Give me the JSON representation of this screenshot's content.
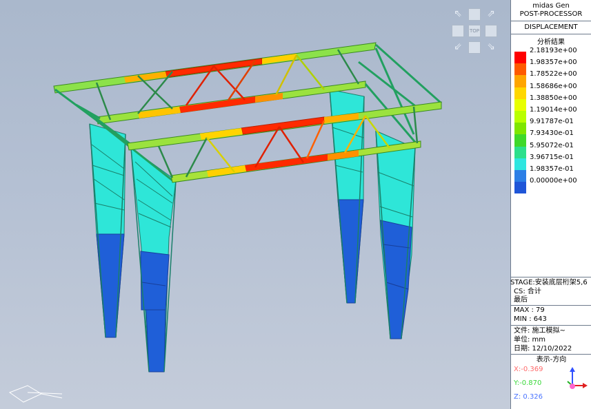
{
  "app": {
    "name": "midas Gen",
    "mode": "POST-PROCESSOR",
    "result_type": "DISPLACEMENT",
    "legend_title": "分析结果"
  },
  "legend": {
    "levels": [
      {
        "value": "2.18193e+00",
        "color": "#ff0000"
      },
      {
        "value": "1.98357e+00",
        "color": "#ff5a00"
      },
      {
        "value": "1.78522e+00",
        "color": "#ffa500"
      },
      {
        "value": "1.58686e+00",
        "color": "#ffd700"
      },
      {
        "value": "1.38850e+00",
        "color": "#e8ff00"
      },
      {
        "value": "1.19014e+00",
        "color": "#b9ff00"
      },
      {
        "value": "9.91787e-01",
        "color": "#7fe600"
      },
      {
        "value": "7.93430e-01",
        "color": "#3fd92a"
      },
      {
        "value": "5.95072e-01",
        "color": "#2de08c"
      },
      {
        "value": "3.96715e-01",
        "color": "#2fe6e0"
      },
      {
        "value": "1.98357e-01",
        "color": "#2c7fe6"
      },
      {
        "value": "0.00000e+00",
        "color": "#1f56d8"
      }
    ]
  },
  "info": {
    "stage": "STAGE:安装底层桁架5,6",
    "cs": "CS: 合计",
    "step": "最后",
    "max": "MAX : 79",
    "min": "MIN : 643",
    "file": "文件: 施工模拟~",
    "unit": "单位: mm",
    "date": "日期: 12/10/2022",
    "direction_title": "表示-方向",
    "x": "X:-0.369",
    "y": "Y:-0.870",
    "z": "Z: 0.326"
  },
  "viewcube": {
    "top_label": "TOP"
  },
  "colors": {
    "x_axis": "#ff6a6a",
    "y_axis": "#39d839",
    "z_axis": "#4a74ff",
    "panel_border": "#6d7a8c"
  }
}
